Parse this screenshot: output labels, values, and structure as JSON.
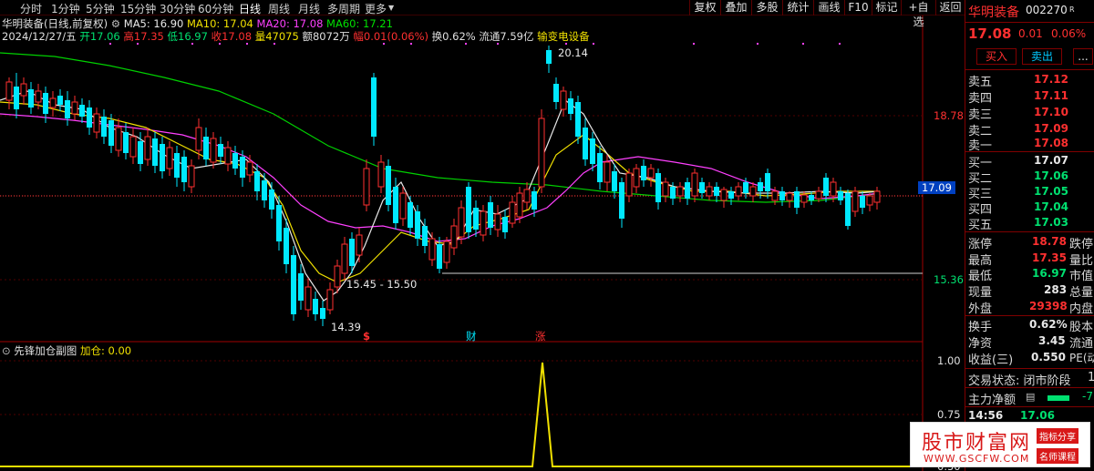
{
  "toolbar": {
    "periods": [
      "分时",
      "1分钟",
      "5分钟",
      "15分钟",
      "30分钟",
      "60分钟",
      "日线",
      "周线",
      "月线",
      "多周期",
      "更多"
    ],
    "active_period": "日线",
    "buttons": [
      "复权",
      "叠加",
      "多股",
      "统计",
      "画线",
      "F10",
      "标记",
      "+自选",
      "返回"
    ]
  },
  "chart_info": {
    "stock_title": "华明装备(日线,前复权)",
    "ma5": "MA5: 16.90",
    "ma10": "MA10: 17.04",
    "ma20": "MA20: 17.08",
    "ma60": "MA60: 17.21",
    "date": "2024/12/27/五",
    "open": "开17.06",
    "high": "高17.35",
    "low": "低16.97",
    "close": "收17.08",
    "volume": "量47075",
    "amount": "额8072万",
    "change": "幅0.01(0.06%)",
    "turnover": "换0.62%",
    "float_cap": "流通7.59亿",
    "sector": "输变电设备"
  },
  "main_chart": {
    "price_labels": [
      "18.78",
      "17.09",
      "15.36"
    ],
    "max_label": "20.14",
    "min_label": "14.39",
    "range_label": "15.45 - 15.50",
    "event_marks": [
      "$",
      "财",
      "涨"
    ]
  },
  "sub_chart": {
    "title": "先锋加仓副图",
    "series_label": "加仓: 0.00",
    "y_labels": [
      "1.00",
      "0.75",
      "0.50"
    ]
  },
  "right_panel": {
    "name": "华明装备",
    "code": "002270",
    "tag": "R",
    "price": "17.08",
    "change": "0.01",
    "change_pct": "0.06%",
    "buy_label": "买入",
    "sell_label": "卖出",
    "more_label": "...",
    "asks": [
      {
        "label": "卖五",
        "price": "17.12"
      },
      {
        "label": "卖四",
        "price": "17.11"
      },
      {
        "label": "卖三",
        "price": "17.10"
      },
      {
        "label": "卖二",
        "price": "17.09"
      },
      {
        "label": "卖一",
        "price": "17.08"
      }
    ],
    "bids": [
      {
        "label": "买一",
        "price": "17.07"
      },
      {
        "label": "买二",
        "price": "17.06"
      },
      {
        "label": "买三",
        "price": "17.05"
      },
      {
        "label": "买四",
        "price": "17.04"
      },
      {
        "label": "买五",
        "price": "17.03"
      }
    ],
    "stats": [
      {
        "label": "涨停",
        "value": "18.78",
        "extra": "跌停"
      },
      {
        "label": "最高",
        "value": "17.35",
        "extra": "量比"
      },
      {
        "label": "最低",
        "value": "16.97",
        "extra": "市值"
      },
      {
        "label": "现量",
        "value": "283",
        "extra": "总量"
      },
      {
        "label": "外盘",
        "value": "29398",
        "extra": "内盘"
      }
    ],
    "stats2": [
      {
        "label": "换手",
        "value": "0.62%",
        "extra": "股本"
      },
      {
        "label": "净资",
        "value": "3.45",
        "extra": "流通"
      },
      {
        "label": "收益(三)",
        "value": "0.550",
        "extra": "PE(动"
      }
    ],
    "trade_status": "交易状态: 闭市阶段",
    "trade_status_extra": "1",
    "main_net": "主力净额",
    "main_net_value": "-7",
    "time": "14:56",
    "time_price": "17.06"
  },
  "watermark": {
    "site_name": "股市财富网",
    "url": "WWW.GSCFW.COM",
    "tag1": "指标分享",
    "tag2": "名师课程"
  },
  "colors": {
    "up": "#ff3030",
    "down": "#00e8ff",
    "ma5": "#ffffff",
    "ma10": "#f0e000",
    "ma20": "#ff40ff",
    "ma60": "#00e000"
  }
}
